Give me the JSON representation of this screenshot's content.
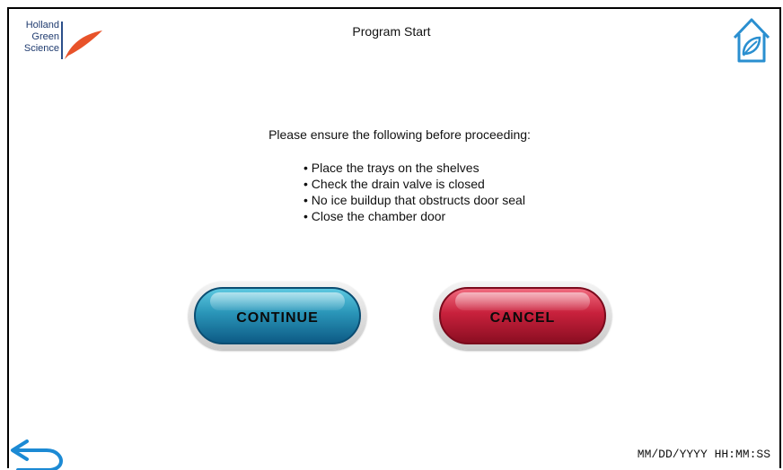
{
  "header": {
    "logo_lines": [
      "Holland",
      "Green",
      "Science"
    ],
    "title": "Program Start",
    "home_icon": "home-leaf-icon"
  },
  "main": {
    "intro": "Please ensure the following before proceeding:",
    "checklist": [
      "Place the trays on the shelves",
      "Check the drain valve is closed",
      "No ice buildup that obstructs door seal",
      "Close the chamber door"
    ],
    "continue_label": "CONTINUE",
    "cancel_label": "CANCEL"
  },
  "footer": {
    "back_icon": "back-arrow-icon",
    "datetime": "MM/DD/YYYY HH:MM:SS"
  },
  "colors": {
    "brand_blue": "#2b4f8a",
    "brand_orange": "#e8532a",
    "icon_blue": "#2a8fd0",
    "continue": "#1e86ad",
    "cancel": "#b81a35"
  }
}
